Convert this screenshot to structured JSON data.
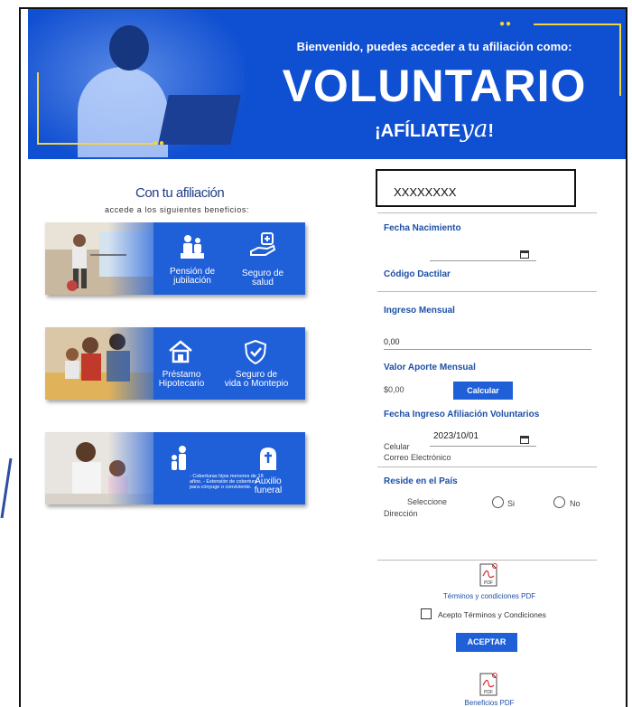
{
  "banner": {
    "welcome": "Bienvenido, puedes acceder a tu afiliación como:",
    "title": "VOLUNTARIO",
    "slogan_main": "¡AFÍLIATE",
    "slogan_script": "ya",
    "slogan_end": "!",
    "accent_color": "#f5d33c",
    "background_color": "#0f4fd1"
  },
  "benefits": {
    "title": "Con tu afiliación",
    "subtitle": "accede a los siguientes beneficios:",
    "cards": [
      {
        "items": [
          {
            "icon": "pension-icon",
            "label_line1": "Pensión de",
            "label_line2": "jubilación"
          },
          {
            "icon": "health-hand-icon",
            "label_line1": "Seguro de",
            "label_line2": "salud"
          }
        ]
      },
      {
        "items": [
          {
            "icon": "house-icon",
            "label_line1": "Préstamo",
            "label_line2": "Hipotecario"
          },
          {
            "icon": "shield-check-icon",
            "label_line1": "Seguro de",
            "label_line2": "vida o Montepio"
          }
        ]
      },
      {
        "items": [
          {
            "icon": "family-icon",
            "label_line1": "",
            "label_line2": ""
          },
          {
            "icon": "tombstone-icon",
            "label_line1": "Auxilio",
            "label_line2": "funeral"
          }
        ],
        "bullets": "- Coberturas hijos menores de 18 años. - Extensión de cobertura para cónyuge o conviviente."
      }
    ]
  },
  "form": {
    "username_value": "XXXXXXXX",
    "birth_date_label": "Fecha Nacimiento",
    "fingerprint_label": "Código Dactilar",
    "income_label": "Ingreso Mensual",
    "income_value": "0,00",
    "contribution_label": "Valor Aporte Mensual",
    "contribution_value": "$0,00",
    "calculate_button": "Calcular",
    "affiliation_date_label": "Fecha Ingreso Afiliación Voluntarios",
    "affiliation_date_value": "2023/10/01",
    "phone_label": "Celular",
    "email_label": "Correo Electrónico",
    "resides_label": "Reside en el País",
    "select_label": "Seleccione",
    "radio_yes": "Si",
    "radio_no": "No",
    "address_label": "Dirección",
    "terms_pdf": "Términos y condiciones PDF",
    "accept_terms": "Acepto Términos y Condiciones",
    "accept_button": "ACEPTAR",
    "benefits_pdf": "Beneficios PDF",
    "pdf_badge": "PDF"
  }
}
